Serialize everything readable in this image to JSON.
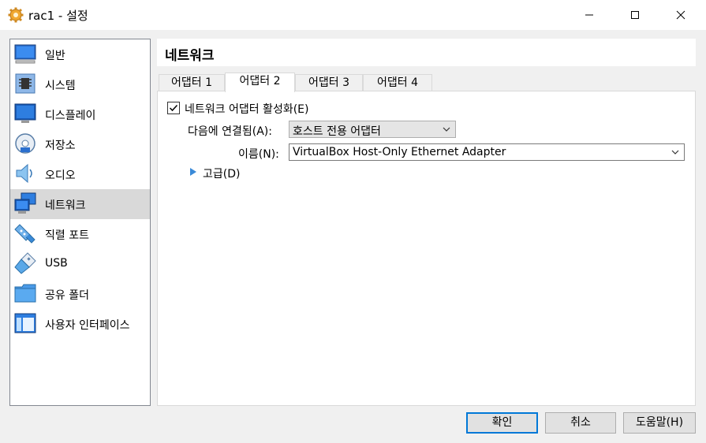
{
  "window": {
    "title": "rac1 - 설정",
    "icons": {
      "app": "gear-icon",
      "minimize": "minimize-icon",
      "maximize": "maximize-icon",
      "close": "close-icon"
    }
  },
  "sidebar": {
    "items": [
      {
        "label": "일반",
        "icon": "monitor-icon"
      },
      {
        "label": "시스템",
        "icon": "chip-icon"
      },
      {
        "label": "디스플레이",
        "icon": "display-icon"
      },
      {
        "label": "저장소",
        "icon": "disk-icon"
      },
      {
        "label": "오디오",
        "icon": "speaker-icon"
      },
      {
        "label": "네트워크",
        "icon": "network-icon",
        "active": true
      },
      {
        "label": "직렬 포트",
        "icon": "serial-port-icon"
      },
      {
        "label": "USB",
        "icon": "usb-icon"
      },
      {
        "label": "공유 폴더",
        "icon": "folder-icon"
      },
      {
        "label": "사용자 인터페이스",
        "icon": "ui-icon"
      }
    ]
  },
  "main": {
    "title": "네트워크",
    "tabs": [
      {
        "label": "어댑터 1"
      },
      {
        "label": "어댑터 2",
        "active": true
      },
      {
        "label": "어댑터 3"
      },
      {
        "label": "어댑터 4"
      }
    ],
    "enable_label": "네트워크 어댑터 활성화(E)",
    "enable_checked": true,
    "attached_label": "다음에 연결됨(A):",
    "attached_value": "호스트 전용 어댑터",
    "name_label": "이름(N):",
    "name_value": "VirtualBox Host-Only Ethernet Adapter",
    "advanced_label": "고급(D)"
  },
  "buttons": {
    "ok": "확인",
    "cancel": "취소",
    "help": "도움말(H)"
  },
  "colors": {
    "accent": "#0078d7",
    "selection": "#d9d9d9",
    "window_bg": "#f0f0f0"
  }
}
